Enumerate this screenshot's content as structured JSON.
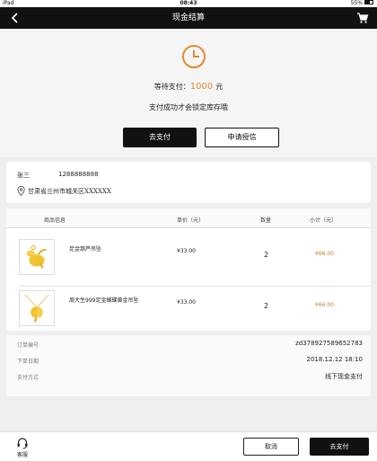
{
  "status_bar": {
    "device": "iPad",
    "time": "08:43",
    "battery": "55%"
  },
  "nav": {
    "title": "现金结算"
  },
  "payment": {
    "await_label": "等待支付：",
    "amount": "1000",
    "unit": "元",
    "hint": "支付成功才会锁定库存哦",
    "pay_button": "去支付",
    "credit_button": "申请授信"
  },
  "address": {
    "name": "张三",
    "phone": "1288888888",
    "detail": "甘肃省兰州市城关区XXXXXX"
  },
  "goods": {
    "headers": [
      "商品信息",
      "单价（元）",
      "数量",
      "小计（元）"
    ],
    "items": [
      {
        "name": "足金葫芦吊坠",
        "price": "¥33.00",
        "qty": "2",
        "subtotal": "¥66.00"
      },
      {
        "name": "周大生999足金蝴蝶黄金吊坠",
        "price": "¥33.00",
        "qty": "2",
        "subtotal": "¥66.00"
      }
    ]
  },
  "order_info": [
    {
      "label": "订单编号",
      "value": "zd378927589652783"
    },
    {
      "label": "下单日期",
      "value": "2018.12.12  18:10"
    },
    {
      "label": "支付方式",
      "value": "线下现金支付"
    }
  ],
  "bottom": {
    "service_label": "客服",
    "cancel_button": "取消",
    "pay_button": "去支付"
  },
  "colors": {
    "accent": "#e48a2d",
    "dark": "#111111",
    "price": "#c0813a"
  }
}
